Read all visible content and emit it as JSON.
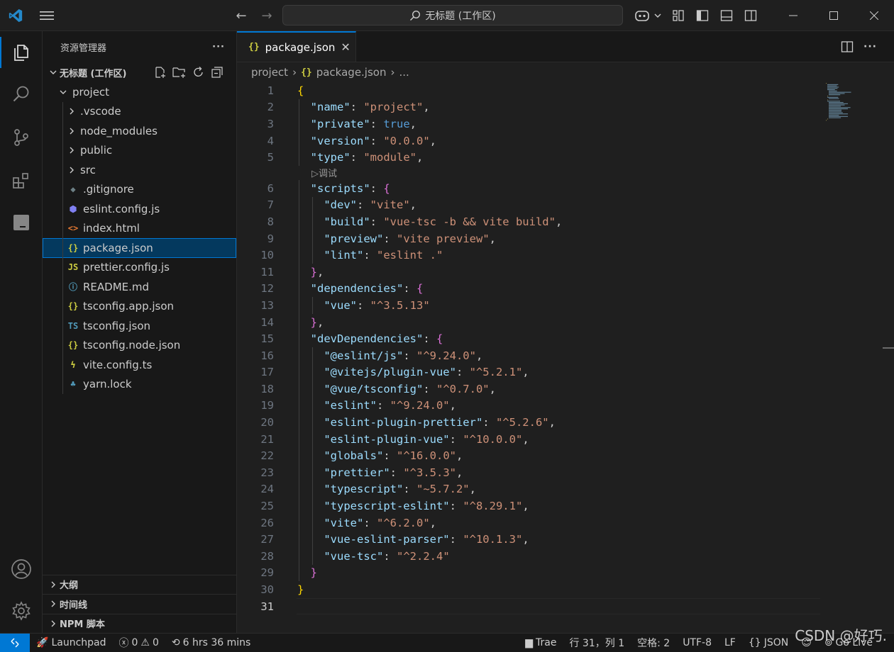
{
  "titlebar": {
    "search_text": "无标题 (工作区)"
  },
  "sidebar": {
    "title": "资源管理器",
    "more": "···",
    "workspace": "无标题 (工作区)",
    "folder": "project",
    "items": [
      {
        "label": ".vscode",
        "kind": "folder"
      },
      {
        "label": "node_modules",
        "kind": "folder"
      },
      {
        "label": "public",
        "kind": "folder"
      },
      {
        "label": "src",
        "kind": "folder"
      },
      {
        "label": ".gitignore",
        "kind": "git",
        "icon": "◆",
        "color": "#6d8086"
      },
      {
        "label": "eslint.config.js",
        "kind": "eslint",
        "icon": "⬢",
        "color": "#8080f2"
      },
      {
        "label": "index.html",
        "kind": "html",
        "icon": "<>",
        "color": "#e37933"
      },
      {
        "label": "package.json",
        "kind": "json",
        "icon": "{}",
        "color": "#cbcb41",
        "selected": true
      },
      {
        "label": "prettier.config.js",
        "kind": "js",
        "icon": "JS",
        "color": "#cbcb41"
      },
      {
        "label": "README.md",
        "kind": "info",
        "icon": "ⓘ",
        "color": "#519aba"
      },
      {
        "label": "tsconfig.app.json",
        "kind": "json",
        "icon": "{}",
        "color": "#cbcb41"
      },
      {
        "label": "tsconfig.json",
        "kind": "ts",
        "icon": "TS",
        "color": "#519aba"
      },
      {
        "label": "tsconfig.node.json",
        "kind": "json",
        "icon": "{}",
        "color": "#cbcb41"
      },
      {
        "label": "vite.config.ts",
        "kind": "vite",
        "icon": "ϟ",
        "color": "#cbcb41"
      },
      {
        "label": "yarn.lock",
        "kind": "yarn",
        "icon": "♣",
        "color": "#519aba"
      }
    ],
    "bottom_sections": [
      "大纲",
      "时间线",
      "NPM 脚本"
    ]
  },
  "editor": {
    "tab": {
      "label": "package.json",
      "icon": "{}"
    },
    "breadcrumb": {
      "root": "project",
      "file": "package.json",
      "rest": "..."
    },
    "codelens": "▷调试",
    "current_line": "31",
    "lines": [
      {
        "n": "1",
        "indent": 0,
        "key": "",
        "val": "",
        "text": "{",
        "open": "br1"
      },
      {
        "n": "2",
        "indent": 1,
        "key": "\"name\"",
        "val": "\"project\"",
        "vtype": "s",
        "comma": true
      },
      {
        "n": "3",
        "indent": 1,
        "key": "\"private\"",
        "val": "true",
        "vtype": "b",
        "comma": true
      },
      {
        "n": "4",
        "indent": 1,
        "key": "\"version\"",
        "val": "\"0.0.0\"",
        "vtype": "s",
        "comma": true
      },
      {
        "n": "5",
        "indent": 1,
        "key": "\"type\"",
        "val": "\"module\"",
        "vtype": "s",
        "comma": true
      },
      {
        "n": "6",
        "indent": 1,
        "key": "\"scripts\"",
        "val": "{",
        "vtype": "br2"
      },
      {
        "n": "7",
        "indent": 2,
        "key": "\"dev\"",
        "val": "\"vite\"",
        "vtype": "s",
        "comma": true
      },
      {
        "n": "8",
        "indent": 2,
        "key": "\"build\"",
        "val": "\"vue-tsc -b && vite build\"",
        "vtype": "s",
        "comma": true
      },
      {
        "n": "9",
        "indent": 2,
        "key": "\"preview\"",
        "val": "\"vite preview\"",
        "vtype": "s",
        "comma": true
      },
      {
        "n": "10",
        "indent": 2,
        "key": "\"lint\"",
        "val": "\"eslint .\"",
        "vtype": "s"
      },
      {
        "n": "11",
        "indent": 1,
        "key": "",
        "val": "",
        "text": "}",
        "close": "br2",
        "comma": true
      },
      {
        "n": "12",
        "indent": 1,
        "key": "\"dependencies\"",
        "val": "{",
        "vtype": "br2"
      },
      {
        "n": "13",
        "indent": 2,
        "key": "\"vue\"",
        "val": "\"^3.5.13\"",
        "vtype": "s"
      },
      {
        "n": "14",
        "indent": 1,
        "key": "",
        "val": "",
        "text": "}",
        "close": "br2",
        "comma": true
      },
      {
        "n": "15",
        "indent": 1,
        "key": "\"devDependencies\"",
        "val": "{",
        "vtype": "br2"
      },
      {
        "n": "16",
        "indent": 2,
        "key": "\"@eslint/js\"",
        "val": "\"^9.24.0\"",
        "vtype": "s",
        "comma": true
      },
      {
        "n": "17",
        "indent": 2,
        "key": "\"@vitejs/plugin-vue\"",
        "val": "\"^5.2.1\"",
        "vtype": "s",
        "comma": true
      },
      {
        "n": "18",
        "indent": 2,
        "key": "\"@vue/tsconfig\"",
        "val": "\"^0.7.0\"",
        "vtype": "s",
        "comma": true
      },
      {
        "n": "19",
        "indent": 2,
        "key": "\"eslint\"",
        "val": "\"^9.24.0\"",
        "vtype": "s",
        "comma": true
      },
      {
        "n": "20",
        "indent": 2,
        "key": "\"eslint-plugin-prettier\"",
        "val": "\"^5.2.6\"",
        "vtype": "s",
        "comma": true
      },
      {
        "n": "21",
        "indent": 2,
        "key": "\"eslint-plugin-vue\"",
        "val": "\"^10.0.0\"",
        "vtype": "s",
        "comma": true
      },
      {
        "n": "22",
        "indent": 2,
        "key": "\"globals\"",
        "val": "\"^16.0.0\"",
        "vtype": "s",
        "comma": true
      },
      {
        "n": "23",
        "indent": 2,
        "key": "\"prettier\"",
        "val": "\"^3.5.3\"",
        "vtype": "s",
        "comma": true
      },
      {
        "n": "24",
        "indent": 2,
        "key": "\"typescript\"",
        "val": "\"~5.7.2\"",
        "vtype": "s",
        "comma": true
      },
      {
        "n": "25",
        "indent": 2,
        "key": "\"typescript-eslint\"",
        "val": "\"^8.29.1\"",
        "vtype": "s",
        "comma": true
      },
      {
        "n": "26",
        "indent": 2,
        "key": "\"vite\"",
        "val": "\"^6.2.0\"",
        "vtype": "s",
        "comma": true
      },
      {
        "n": "27",
        "indent": 2,
        "key": "\"vue-eslint-parser\"",
        "val": "\"^10.1.3\"",
        "vtype": "s",
        "comma": true
      },
      {
        "n": "28",
        "indent": 2,
        "key": "\"vue-tsc\"",
        "val": "\"^2.2.4\"",
        "vtype": "s"
      },
      {
        "n": "29",
        "indent": 1,
        "key": "",
        "val": "",
        "text": "}",
        "close": "br2"
      },
      {
        "n": "30",
        "indent": 0,
        "key": "",
        "val": "",
        "text": "}",
        "close": "br1"
      },
      {
        "n": "31",
        "indent": 0,
        "key": "",
        "val": "",
        "text": ""
      }
    ]
  },
  "status": {
    "launchpad": "Launchpad",
    "errors": "0",
    "warnings": "0",
    "time": "6 hrs 36 mins",
    "trae": "Trae",
    "position": "行 31，列 1",
    "spaces": "空格: 2",
    "encoding": "UTF-8",
    "eol": "LF",
    "language": "JSON",
    "golive": "Go Live"
  },
  "watermark": "CSDN @好巧.",
  "colors": {
    "accent": "#0078d4",
    "key": "#9cdcfe",
    "string": "#ce9178",
    "bool": "#569cd6",
    "bracket1": "#ffd700",
    "bracket2": "#da70d6"
  }
}
